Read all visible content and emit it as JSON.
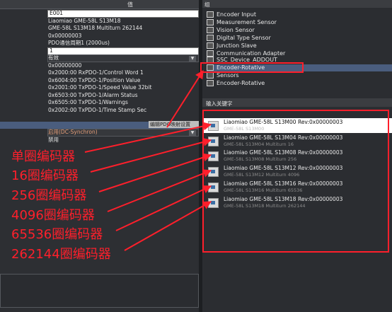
{
  "properties": {
    "value_header": "值",
    "rows": [
      {
        "value": "E001",
        "kind": "edit"
      },
      {
        "value": "Liaomiao GME-58L S13M18",
        "kind": "text"
      },
      {
        "value": "GME-58L S13M18 Multiturn 262144",
        "kind": "text"
      },
      {
        "value": "0x00000003",
        "kind": "text"
      },
      {
        "value": "PDO通信周期1 (2000us)",
        "kind": "text"
      },
      {
        "value": "1",
        "kind": "edit"
      },
      {
        "value": "有效",
        "kind": "combo"
      },
      {
        "value": "0x00000000",
        "kind": "text"
      },
      {
        "value": "0x2000:00 RxPDO-1/Control Word 1",
        "kind": "text"
      },
      {
        "value": "0x6004:00 TxPDO-1/Position Value",
        "kind": "text"
      },
      {
        "value": "0x2001:00 TxPDO-1/Speed Value 32bit",
        "kind": "text"
      },
      {
        "value": "0x6503:00 TxPDO-1/Alarm Status",
        "kind": "text"
      },
      {
        "value": "0x6505:00 TxPDO-1/Warnings",
        "kind": "text"
      },
      {
        "value": "0x2002:00 TxPDO-1/Time Stamp Sec",
        "kind": "text"
      },
      {
        "value": "",
        "kind": "text"
      },
      {
        "value": "",
        "kind": "sel"
      },
      {
        "value": "启用(DC-Synchron)",
        "kind": "combo"
      },
      {
        "value": "禁用",
        "kind": "text"
      }
    ],
    "edit_pdo_button": "编辑PDO映射设置"
  },
  "annotations": [
    "单圈编码器",
    "16圈编码器",
    "256圈编码器",
    "4096圈编码器",
    "65536圈编码器",
    "262144圈编码器"
  ],
  "groups": {
    "header": "组",
    "items": [
      "Encoder Input",
      "Measurement Sensor",
      "Vision Sensor",
      "Digital Type Sensor",
      "Junction Slave",
      "Communication Adapter",
      "SSC_Device_ADDOUT",
      "Encoder-Rotative",
      "Sensors",
      "Encoder-Rotative"
    ]
  },
  "keyword": {
    "header": "输入关键字"
  },
  "devices": [
    {
      "name": "Liaomiao GME-58L S13M00 Rev:0x00000003",
      "sub": "GME-58L S13M00"
    },
    {
      "name": "Liaomiao GME-58L S13M04 Rev:0x00000003",
      "sub": "GME-58L S13M04 Multiturn 16"
    },
    {
      "name": "Liaomiao GME-58L S13M08 Rev:0x00000003",
      "sub": "GME-58L S13M08 Multiturn 256"
    },
    {
      "name": "Liaomiao GME-58L S13M12 Rev:0x00000003",
      "sub": "GME-58L S13M12 Multiturn 4096"
    },
    {
      "name": "Liaomiao GME-58L S13M16 Rev:0x00000003",
      "sub": "GME-58L S13M16 Multiturn 65536"
    },
    {
      "name": "Liaomiao GME-58L S13M18 Rev:0x00000003",
      "sub": "GME-58L S13M18 Multiturn 262144"
    }
  ],
  "colors": {
    "annotation": "#ff1f2b",
    "selection": "#4a5d7e"
  }
}
